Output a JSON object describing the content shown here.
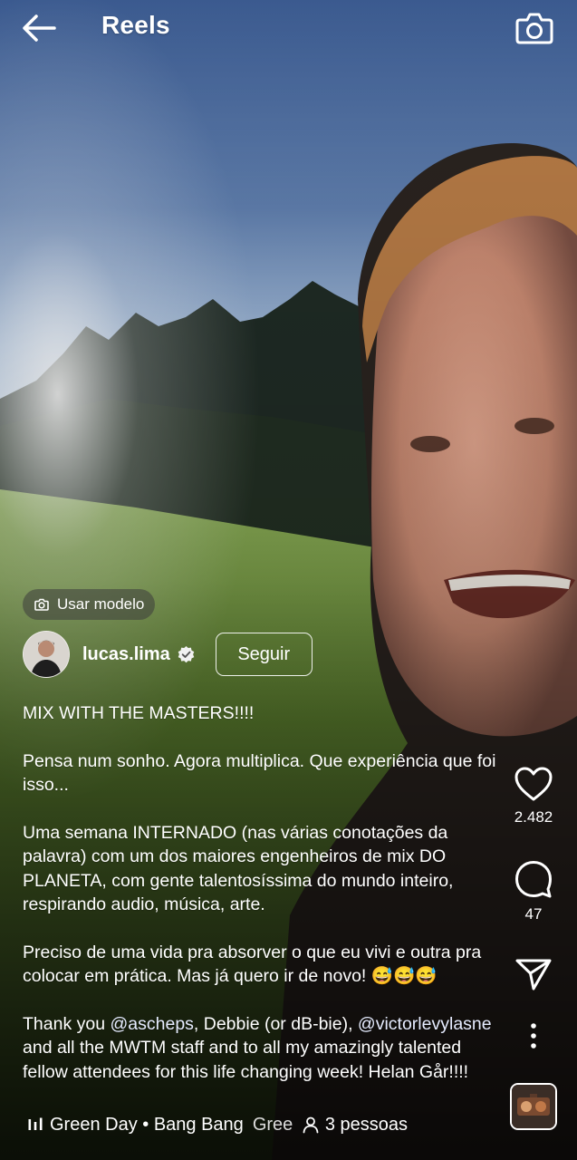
{
  "header": {
    "title": "Reels",
    "back_icon": "arrow-left-icon",
    "camera_icon": "camera-icon"
  },
  "template": {
    "label": "Usar modelo",
    "icon": "camera-small-icon"
  },
  "author": {
    "username": "lucas.lima",
    "verified_icon": "verified-badge-icon",
    "follow_label": "Seguir"
  },
  "caption": {
    "p1": "MIX WITH THE MASTERS!!!!",
    "p2": "Pensa num sonho. Agora multiplica. Que experiência que foi isso...",
    "p3": "Uma semana INTERNADO (nas várias conotações da palavra) com um dos maiores engenheiros de mix DO PLANETA, com gente talentosíssima do mundo inteiro, respirando audio, música, arte.",
    "p4": "Preciso de uma vida pra absorver o que eu vivi e outra pra colocar em prática. Mas já quero ir de novo! 😅😅😅",
    "p5_prefix": "Thank you ",
    "p5_mention1": "@ascheps",
    "p5_mid": ", Debbie (or dB-bie), ",
    "p5_mention2": "@victorlevylasne",
    "p5_suffix": " and all the MWTM staff and to all my amazingly talented fellow attendees for this life changing week! Helan Går!!!!"
  },
  "actions": {
    "like_icon": "heart-icon",
    "likes": "2.482",
    "comment_icon": "comment-icon",
    "comments": "47",
    "share_icon": "send-icon",
    "more_icon": "more-vertical-icon"
  },
  "music": {
    "icon": "equalizer-icon",
    "song": "Green Day • Bang Bang",
    "song_repeat": "Green Day • Bang Bang",
    "people_icon": "person-icon",
    "people": "3 pessoas"
  },
  "colors": {
    "sky_top": "#3e5e92",
    "sky_bottom": "#a7c0dd",
    "grass": "#6f9a3c",
    "text": "#ffffff"
  }
}
